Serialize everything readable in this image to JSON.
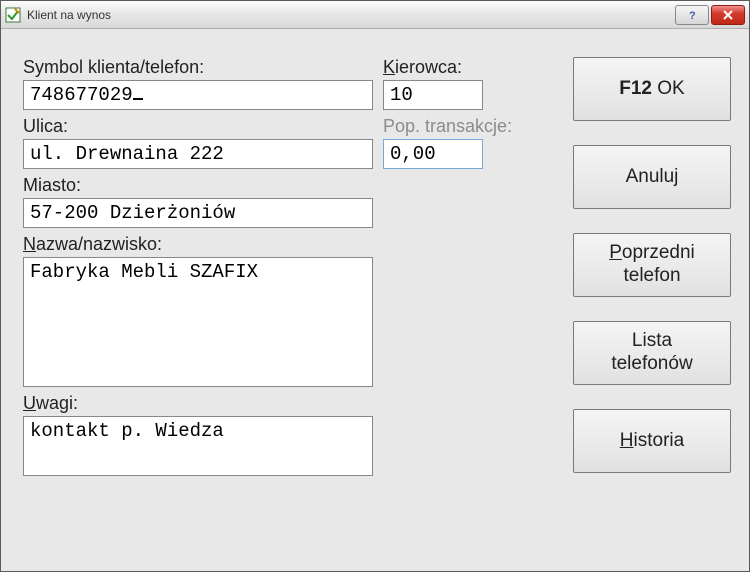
{
  "titlebar": {
    "title": "Klient na wynos"
  },
  "labels": {
    "symbol": "Symbol klienta/telefon:",
    "ulica": "Ulica:",
    "miasto": "Miasto:",
    "nazwa_pre": "N",
    "nazwa_post": "azwa/nazwisko:",
    "uwagi_pre": "U",
    "uwagi_post": "wagi:",
    "kierowca_pre": "K",
    "kierowca_post": "ierowca:",
    "pop": "Pop. transakcje:"
  },
  "fields": {
    "symbol": "748677029",
    "ulica": "ul. Drewnaina 222",
    "miasto": "57-200 Dzierżoniów",
    "nazwa": "Fabryka Mebli SZAFIX",
    "uwagi": "kontakt p. Wiedza",
    "kierowca": "10",
    "pop": "0,00"
  },
  "buttons": {
    "ok_bold": "F12",
    "ok_rest": " OK",
    "anuluj": "Anuluj",
    "poprzedni_pre": "P",
    "poprzedni_mid": "oprzedni",
    "poprzedni_line2": "telefon",
    "lista_line1": "Lista",
    "lista_line2": "telefonów",
    "historia_pre": "H",
    "historia_post": "istoria"
  }
}
